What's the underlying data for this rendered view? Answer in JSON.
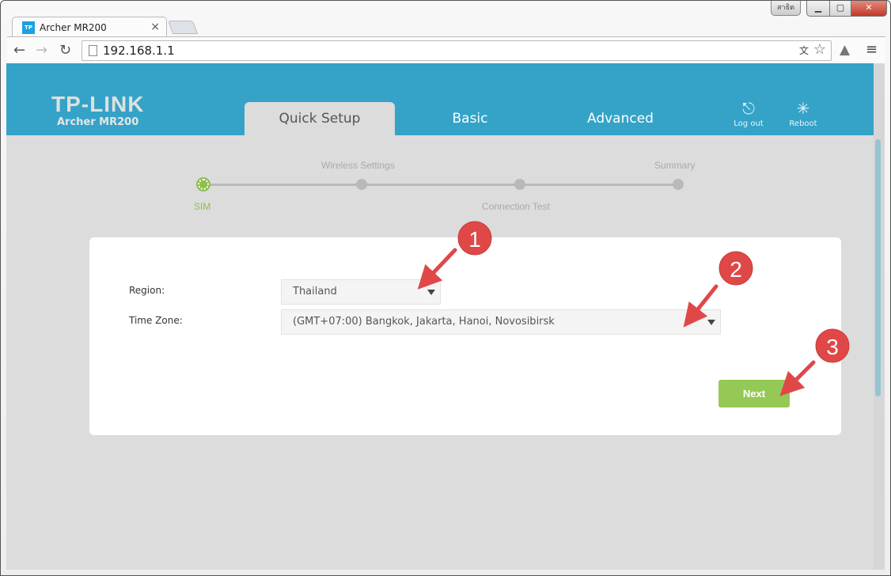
{
  "browser": {
    "tab_title": "Archer MR200",
    "tab_icon_text": "TP",
    "url": "192.168.1.1",
    "profile_label": "สาธิต"
  },
  "header": {
    "logo": "TP-LINK",
    "model": "Archer MR200",
    "tabs": [
      {
        "label": "Quick Setup",
        "active": true
      },
      {
        "label": "Basic"
      },
      {
        "label": "Advanced"
      }
    ],
    "logout": "Log out",
    "reboot": "Reboot"
  },
  "steps": [
    {
      "label": "SIM",
      "active": true
    },
    {
      "label": "Wireless Settings"
    },
    {
      "label": "Connection Test"
    },
    {
      "label": "Summary"
    }
  ],
  "form": {
    "region_label": "Region:",
    "region_value": "Thailand",
    "timezone_label": "Time Zone:",
    "timezone_value": "(GMT+07:00) Bangkok, Jakarta, Hanoi, Novosibirsk",
    "next_label": "Next"
  },
  "annotations": [
    "1",
    "2",
    "3"
  ],
  "colors": {
    "header": "#35a3c8",
    "accent_green": "#95c955",
    "annotation_red": "#e04848"
  }
}
